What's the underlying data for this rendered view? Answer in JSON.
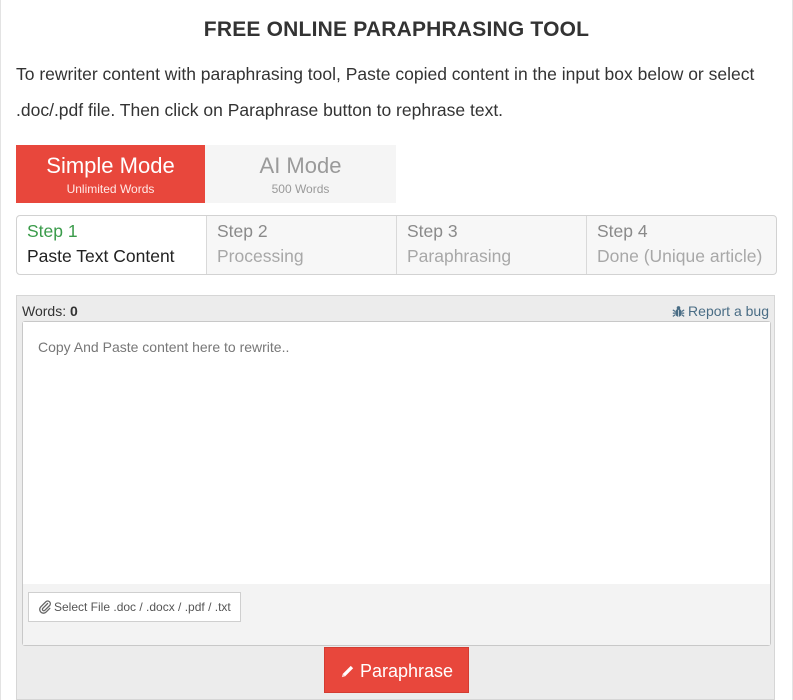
{
  "page": {
    "title": "FREE ONLINE PARAPHRASING TOOL",
    "intro": "To rewriter content with paraphrasing tool, Paste copied content in the input box below or select .doc/.pdf file. Then click on Paraphrase button to rephrase text."
  },
  "modes": [
    {
      "name": "Simple Mode",
      "sub": "Unlimited Words",
      "active": true
    },
    {
      "name": "AI Mode",
      "sub": "500 Words",
      "active": false
    }
  ],
  "steps": [
    {
      "num": "Step 1",
      "label": "Paste Text Content",
      "current": true
    },
    {
      "num": "Step 2",
      "label": "Processing",
      "current": false
    },
    {
      "num": "Step 3",
      "label": "Paraphrasing",
      "current": false
    },
    {
      "num": "Step 4",
      "label": "Done (Unique article)",
      "current": false
    }
  ],
  "editor": {
    "words_label": "Words:",
    "words_count": "0",
    "report_bug": "Report a bug",
    "value": "",
    "placeholder": "Copy And Paste content here to rewrite..",
    "file_button": "Select File .doc / .docx / .pdf / .txt",
    "paraphrase_button": "Paraphrase"
  },
  "icons": {
    "bug": "bug-icon",
    "paperclip": "paperclip-icon",
    "pencil": "pencil-icon"
  },
  "colors": {
    "accent": "#e8473c",
    "step_active": "#3a9b4a",
    "link": "#4a6d85"
  }
}
